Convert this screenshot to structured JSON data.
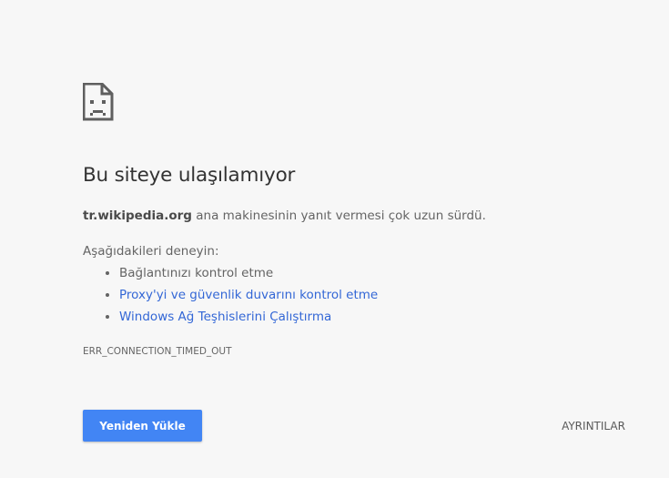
{
  "error": {
    "icon": "sad-page-icon",
    "title": "Bu siteye ulaşılamıyor",
    "host": "tr.wikipedia.org",
    "summary_rest": " ana makinesinin yanıt vermesi çok uzun sürdü.",
    "suggestions_title": "Aşağıdakileri deneyin:",
    "suggestions": [
      {
        "label": "Bağlantınızı kontrol etme",
        "link": false
      },
      {
        "label": "Proxy'yi ve güvenlik duvarını kontrol etme",
        "link": true
      },
      {
        "label": "Windows Ağ Teşhislerini Çalıştırma",
        "link": true
      }
    ],
    "code": "ERR_CONNECTION_TIMED_OUT"
  },
  "buttons": {
    "reload_label": "Yeniden Yükle",
    "details_label": "AYRINTILAR"
  },
  "colors": {
    "background": "#f7f7f7",
    "link": "#3367d6",
    "primary_button": "#4285f4"
  }
}
